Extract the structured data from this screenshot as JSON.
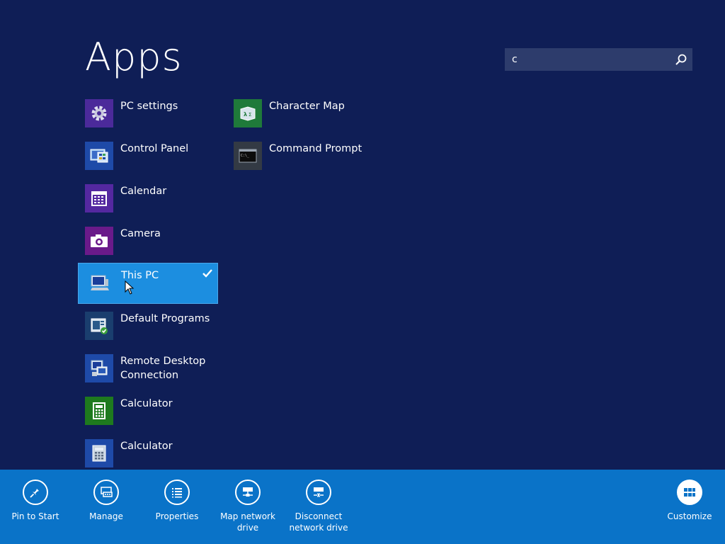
{
  "screen": {
    "title": "Apps"
  },
  "search": {
    "value": "c",
    "icon": "search-icon"
  },
  "apps": [
    {
      "label": "PC settings",
      "icon": "gear-icon",
      "tile_color": "#4b2a9a"
    },
    {
      "label": "Control Panel",
      "icon": "control-panel-icon",
      "tile_color": "#1e4aa8"
    },
    {
      "label": "Calendar",
      "icon": "calendar-icon",
      "tile_color": "#5428a0"
    },
    {
      "label": "Camera",
      "icon": "camera-icon",
      "tile_color": "#6a1a8a"
    },
    {
      "label": "This PC",
      "icon": "computer-icon",
      "tile_color": "#1c8ee0",
      "selected": true
    },
    {
      "label": "Default Programs",
      "icon": "default-programs-icon",
      "tile_color": "#1a3e6e"
    },
    {
      "label": "Remote Desktop",
      "label2": "Connection",
      "icon": "remote-desktop-icon",
      "tile_color": "#1e4aa8"
    },
    {
      "label": "Calculator",
      "icon": "calculator-icon",
      "tile_color": "#1e7a1e"
    },
    {
      "label": "Calculator",
      "icon": "calculator-icon",
      "tile_color": "#1e4aa8"
    },
    {
      "label": "Character Map",
      "icon": "character-map-icon",
      "tile_color": "#1f7a3a"
    },
    {
      "label": "Command Prompt",
      "icon": "command-prompt-icon",
      "tile_color": "#333a44"
    }
  ],
  "appbar": {
    "buttons": [
      {
        "label": "Pin to Start",
        "icon": "pin-icon"
      },
      {
        "label": "Manage",
        "icon": "manage-icon"
      },
      {
        "label": "Properties",
        "icon": "properties-icon"
      },
      {
        "label": "Map network",
        "label2": "drive",
        "icon": "map-network-drive-icon"
      },
      {
        "label": "Disconnect",
        "label2": "network drive",
        "icon": "disconnect-network-drive-icon"
      },
      {
        "label": "Customize",
        "icon": "customize-icon"
      }
    ]
  },
  "colors": {
    "background": "#0f1e56",
    "accent": "#1c8ee0",
    "appbar": "#0a73c8",
    "search_bg": "#2d3c6c"
  }
}
